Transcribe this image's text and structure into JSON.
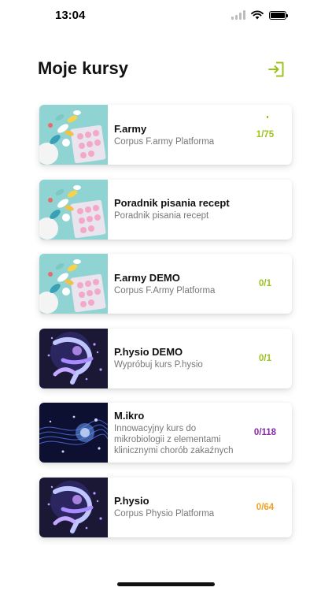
{
  "status_bar": {
    "time": "13:04"
  },
  "header": {
    "title": "Moje kursy",
    "logout_icon": "logout-icon"
  },
  "colors": {
    "green": "#9bc31c",
    "purple": "#8a2aa8",
    "orange": "#f0a020"
  },
  "courses": [
    {
      "title": "F.army",
      "subtitle": "Corpus F.army Platforma",
      "progress": "1/75",
      "progress_color": "#9bc31c",
      "thumbnail": "pills"
    },
    {
      "title": "Poradnik pisania recept",
      "subtitle": "Poradnik pisania recept",
      "progress": "",
      "progress_color": "#9bc31c",
      "thumbnail": "pills"
    },
    {
      "title": "F.army DEMO",
      "subtitle": "Corpus F.Army Platforma",
      "progress": "0/1",
      "progress_color": "#9bc31c",
      "thumbnail": "pills"
    },
    {
      "title": "P.hysio DEMO",
      "subtitle": "Wypróbuj kurs P.hysio",
      "progress": "0/1",
      "progress_color": "#9bc31c",
      "thumbnail": "runner"
    },
    {
      "title": "M.ikro",
      "subtitle": "Innowacyjny kurs do mikrobiologii z elementami klinicznymi chorób zakaźnych",
      "progress": "0/118",
      "progress_color": "#8a2aa8",
      "thumbnail": "microbe"
    },
    {
      "title": "P.hysio",
      "subtitle": "Corpus Physio Platforma",
      "progress": "0/64",
      "progress_color": "#f0a020",
      "thumbnail": "runner"
    }
  ]
}
